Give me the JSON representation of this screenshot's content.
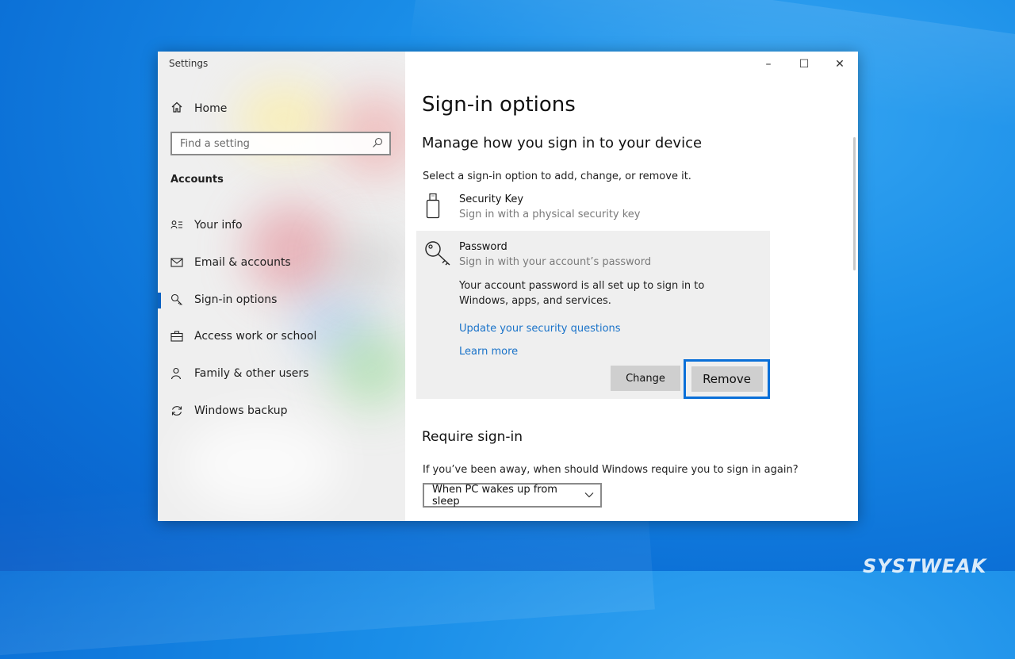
{
  "window": {
    "title": "Settings",
    "controls": {
      "minimize": "–",
      "maximize": "☐",
      "close": "✕"
    }
  },
  "nav": {
    "home_label": "Home",
    "search_placeholder": "Find a setting",
    "section_title": "Accounts",
    "items": [
      {
        "label": "Your info",
        "icon": "person-card-icon"
      },
      {
        "label": "Email & accounts",
        "icon": "mail-icon"
      },
      {
        "label": "Sign-in options",
        "icon": "key-icon",
        "active": true
      },
      {
        "label": "Access work or school",
        "icon": "briefcase-icon"
      },
      {
        "label": "Family & other users",
        "icon": "person-add-icon"
      },
      {
        "label": "Windows backup",
        "icon": "sync-icon"
      }
    ]
  },
  "main": {
    "title": "Sign-in options",
    "subtitle": "Manage how you sign in to your device",
    "description": "Select a sign-in option to add, change, or remove it.",
    "options": [
      {
        "title": "Security Key",
        "subtitle": "Sign in with a physical security key",
        "icon": "usb-key-icon"
      },
      {
        "title": "Password",
        "subtitle": "Sign in with your account’s password",
        "icon": "password-key-icon",
        "expanded": true
      }
    ],
    "password_panel": {
      "body": "Your account password is all set up to sign in to Windows, apps, and services.",
      "link_update": "Update your security questions",
      "link_learn": "Learn more",
      "change_label": "Change",
      "remove_label": "Remove"
    },
    "require": {
      "heading": "Require sign-in",
      "question": "If you’ve been away, when should Windows require you to sign in again?",
      "selected": "When PC wakes up from sleep"
    }
  },
  "colors": {
    "accent": "#0a6fd8",
    "link": "#1a73c9",
    "desktop": "#1a8ee8"
  },
  "watermark": "SYSTWEAK"
}
